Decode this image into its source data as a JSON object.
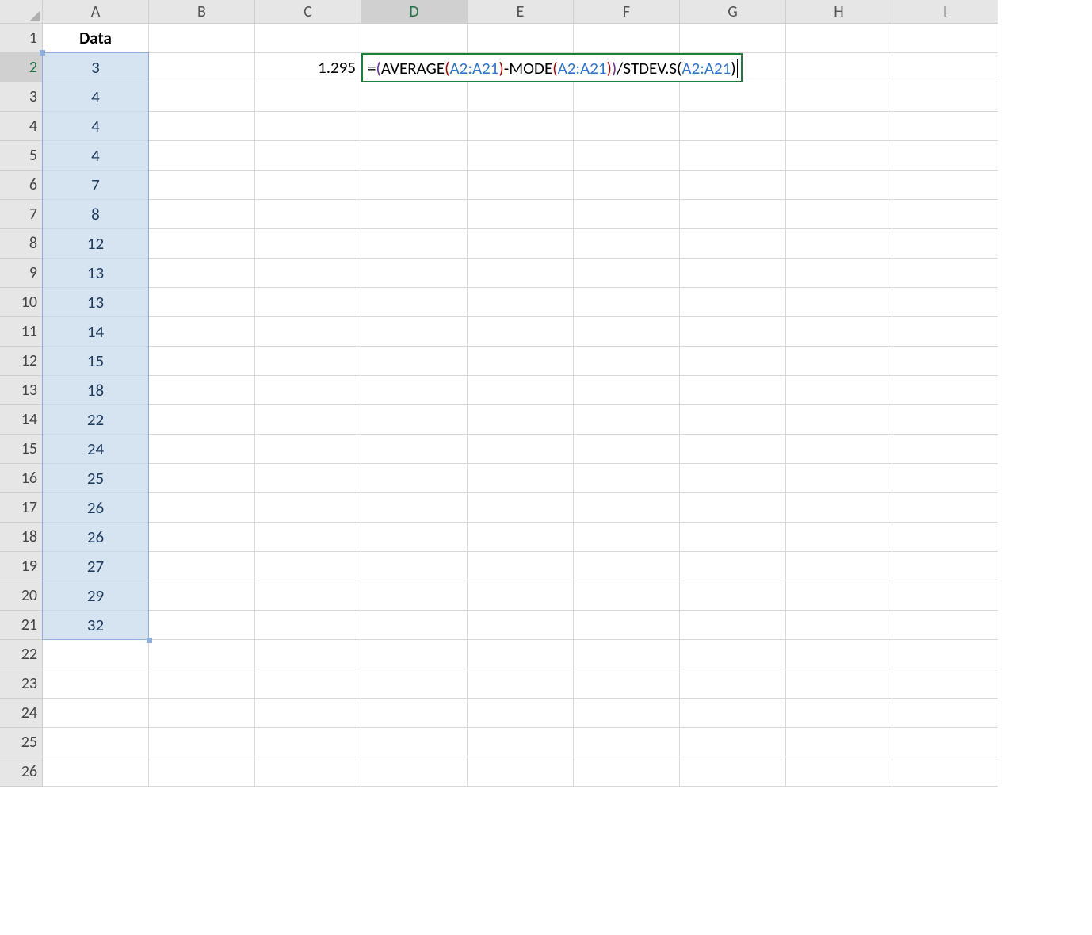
{
  "columns": [
    "A",
    "B",
    "C",
    "D",
    "E",
    "F",
    "G",
    "H",
    "I"
  ],
  "rows": [
    "1",
    "2",
    "3",
    "4",
    "5",
    "6",
    "7",
    "8",
    "9",
    "10",
    "11",
    "12",
    "13",
    "14",
    "15",
    "16",
    "17",
    "18",
    "19",
    "20",
    "21",
    "22",
    "23",
    "24",
    "25",
    "26"
  ],
  "header_label": "Data",
  "data_values": [
    "3",
    "4",
    "4",
    "4",
    "7",
    "8",
    "12",
    "13",
    "13",
    "14",
    "15",
    "18",
    "22",
    "24",
    "25",
    "26",
    "26",
    "27",
    "29",
    "32"
  ],
  "c2_value": "1.295",
  "formula": {
    "eq": "=",
    "lp1": "(",
    "avg": "AVERAGE",
    "lp2": "(",
    "ref1": "A2:A21",
    "rp2": ")",
    "minus": "-",
    "mode": "MODE",
    "lp3": "(",
    "ref2": "A2:A21",
    "rp3": ")",
    "rp1": ")",
    "slash": "/",
    "stdev": "STDEV.S",
    "lp4": "(",
    "ref3": "A2:A21",
    "rp4": ")"
  },
  "active_column": "D",
  "active_row": "2"
}
